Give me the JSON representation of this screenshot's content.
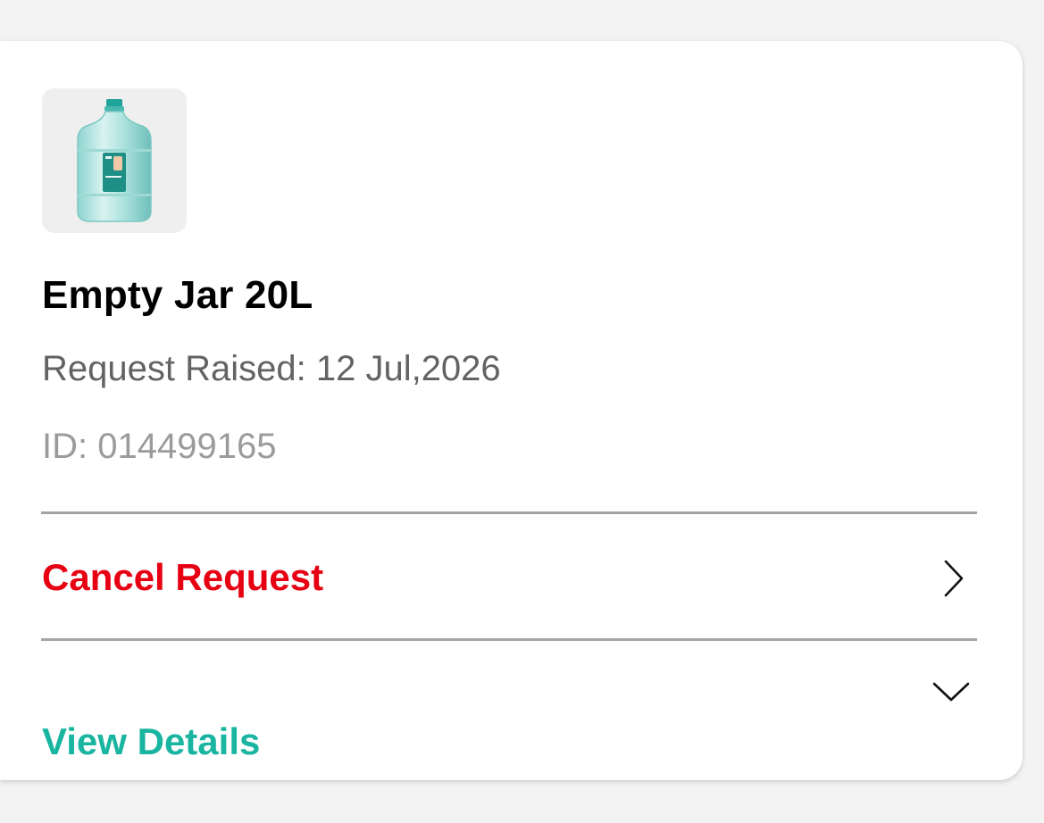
{
  "product": {
    "image_alt": "water-jar-icon",
    "name": "Empty Jar 20L",
    "request_raised": "Request Raised: 12 Jul,2026",
    "request_id": "ID: 014499165"
  },
  "actions": {
    "cancel_label": "Cancel Request",
    "details_label": "View Details"
  },
  "colors": {
    "cancel": "#e60012",
    "details": "#19b5a0",
    "divider": "#a4a4a4",
    "background": "#f3f3f3"
  },
  "icons": {
    "cancel_chevron": "chevron-right-icon",
    "details_chevron": "chevron-down-icon"
  }
}
